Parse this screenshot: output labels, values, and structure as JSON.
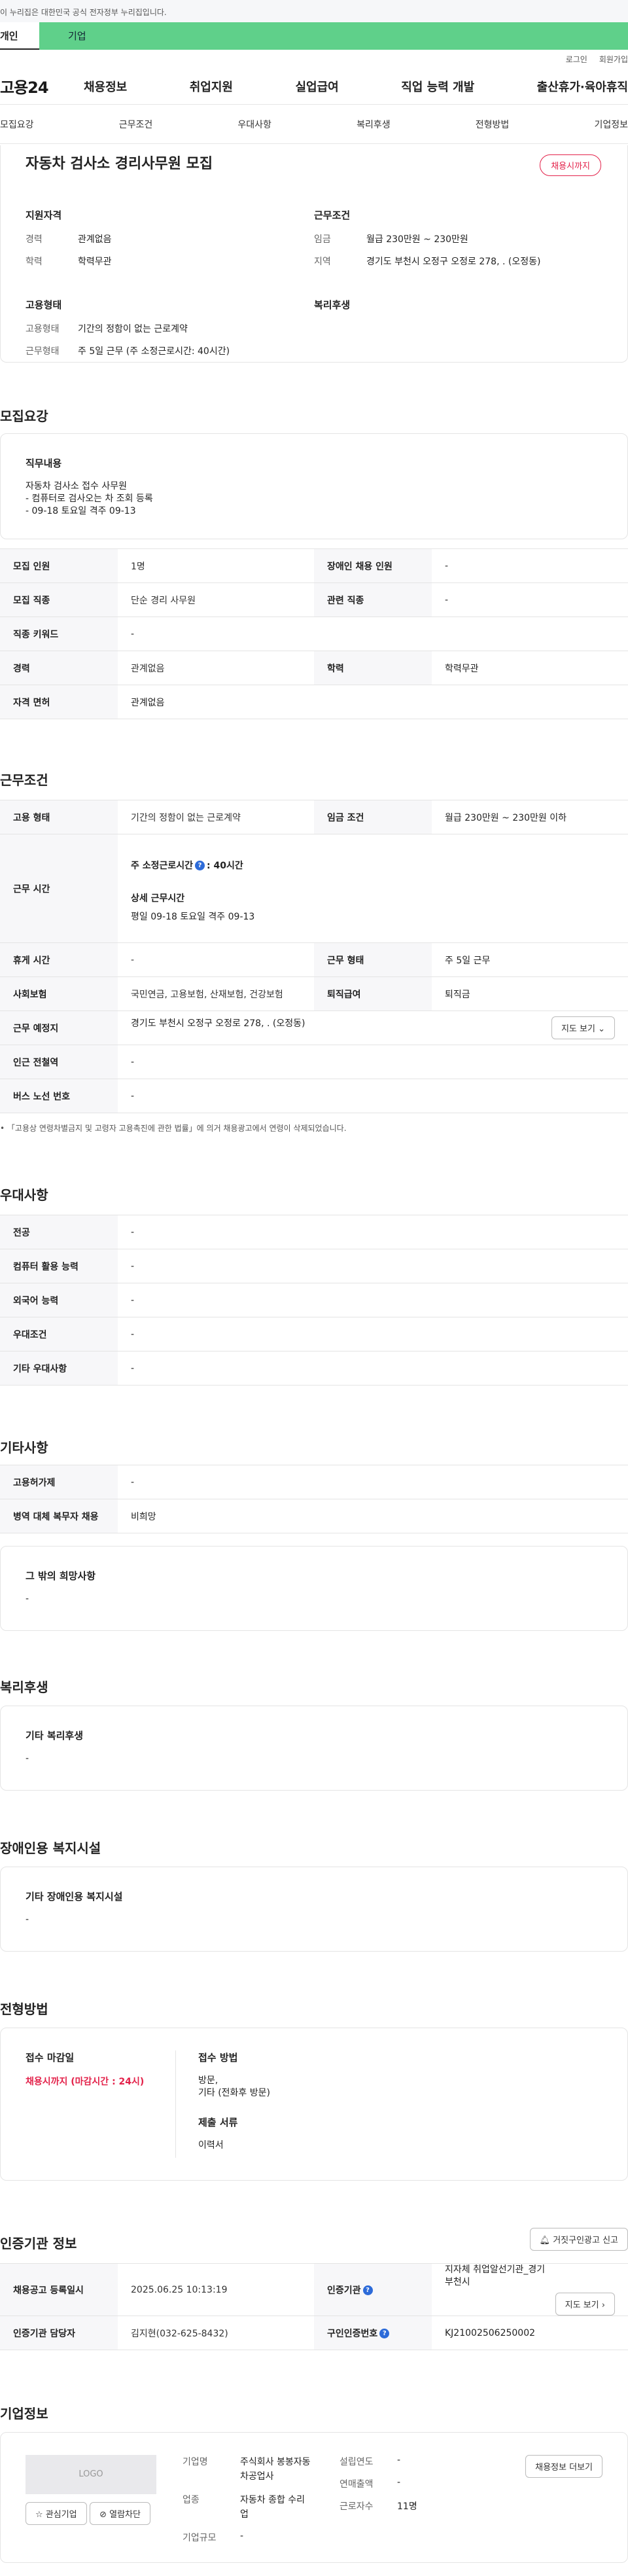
{
  "gov_banner": "이 누리집은 대한민국 공식 전자정부 누리집입니다.",
  "top_tabs": {
    "person": "개인",
    "company": "기업"
  },
  "util": {
    "login": "로그인",
    "join": "회원가입"
  },
  "gnb": {
    "logo": "고용24",
    "menu": [
      "채용정보",
      "취업지원",
      "실업급여",
      "직업 능력 개발",
      "출산휴가·육아휴직"
    ]
  },
  "anchor_tabs": [
    "모집요강",
    "근무조건",
    "우대사항",
    "복리후생",
    "전형방법",
    "기업정보"
  ],
  "summary": {
    "title": "자동차 검사소 경리사무원 모집",
    "badge": "채용시까지",
    "qual_title": "지원자격",
    "career_k": "경력",
    "career_v": "관계없음",
    "edu_k": "학력",
    "edu_v": "학력무관",
    "emp_title": "고용형태",
    "emp_k": "고용형태",
    "emp_v": "기간의 정함이 없는 근로계약",
    "work_k": "근무형태",
    "work_v": "주 5일 근무 (주 소정근로시간: 40시간)",
    "cond_title": "근무조건",
    "wage_k": "임금",
    "wage_v": "월급 230만원 ~ 230만원",
    "region_k": "지역",
    "region_v": "경기도 부천시 오정구 오정로 278, . (오정동)",
    "welfare_title": "복리후생"
  },
  "recruit": {
    "title": "모집요강",
    "duty_title": "직무내용",
    "duty_body": "자동차 검사소  접수 사무원\n- 컴퓨터로 검사오는 차 조회 등록\n- 09-18 토요일 격주 09-13",
    "rows": [
      [
        "모집 인원",
        "1명",
        "장애인 채용 인원",
        "-"
      ],
      [
        "모집 직종",
        "단순 경리 사무원",
        "관련 직종",
        "-"
      ],
      [
        "직종 키워드",
        "-"
      ],
      [
        "경력",
        "관계없음",
        "학력",
        "학력무관"
      ],
      [
        "자격 면허",
        "관계없음"
      ]
    ]
  },
  "work": {
    "title": "근무조건",
    "emp_k": "고용 형태",
    "emp_v": "기간의 정함이 없는 근로계약",
    "wage_k": "임금 조건",
    "wage_v": "월급 230만원 ~ 230만원 이하",
    "hours_k": "근무 시간",
    "hours_week": "주 소정근로시간",
    "hours_week_v": ": 40시간",
    "hours_detail_t": "상세 근무시간",
    "hours_detail_v": "평일 09-18 토요일 격주 09-13",
    "rest_k": "휴게 시간",
    "rest_v": "-",
    "type_k": "근무 형태",
    "type_v": "주 5일 근무",
    "ins_k": "사회보험",
    "ins_v": "국민연금, 고용보험, 산재보험, 건강보험",
    "sev_k": "퇴직급여",
    "sev_v": "퇴직금",
    "place_k": "근무 예정지",
    "place_v": "경기도 부천시 오정구 오정로 278, . (오정동)",
    "map_btn": "지도 보기",
    "station_k": "인근 전철역",
    "station_v": "-",
    "bus_k": "버스 노선 번호",
    "bus_v": "-",
    "note": "「고용상 연령차별금지 및 고령자 고용촉진에 관한 법률」에 의거 채용광고에서 연령이 삭제되었습니다."
  },
  "pref": {
    "title": "우대사항",
    "rows": [
      [
        "전공",
        "-"
      ],
      [
        "컴퓨터 활용 능력",
        "-"
      ],
      [
        "외국어 능력",
        "-"
      ],
      [
        "우대조건",
        "-"
      ],
      [
        "기타 우대사항",
        "-"
      ]
    ]
  },
  "etc": {
    "title": "기타사항",
    "rows": [
      [
        "고용허가제",
        "-"
      ],
      [
        "병역 대체 복무자 채용",
        "비희망"
      ]
    ],
    "box_title": "그 밖의 희망사항",
    "box_body": "-"
  },
  "welfare": {
    "title": "복리후생",
    "box_title": "기타 복리후생",
    "box_body": "-"
  },
  "disabled": {
    "title": "장애인용 복지시설",
    "box_title": "기타 장애인용 복지시설",
    "box_body": "-"
  },
  "selection": {
    "title": "전형방법",
    "deadline_t": "접수 마감일",
    "deadline_v": "채용시까지 (마감시간 : 24시)",
    "method_t": "접수 방법",
    "method_v": "방문,\n기타 (전화후 방문)",
    "docs_t": "제출 서류",
    "docs_v": "이력서"
  },
  "agency": {
    "title": "인증기관 정보",
    "report_btn": "거짓구인광고 신고",
    "date_k": "채용공고 등록일시",
    "date_v": "2025.06.25 10:13:19",
    "org_k": "인증기관",
    "org_v": "지자체 취업알선기관_경기 부천시",
    "map_btn": "지도 보기",
    "mgr_k": "인증기관 담당자",
    "mgr_v": "김지현(032-625-8432)",
    "no_k": "구인인증번호",
    "no_v": "KJ21002506250002"
  },
  "company": {
    "title": "기업정보",
    "logo": "LOGO",
    "fav_btn": "관심기업",
    "block_btn": "열람차단",
    "name_k": "기업명",
    "name_v": "주식회사 봉봉자동차공업사",
    "ind_k": "업종",
    "ind_v": "자동차 종합 수리업",
    "size_k": "기업규모",
    "size_v": "-",
    "est_k": "설립연도",
    "est_v": "-",
    "sales_k": "연매출액",
    "sales_v": "-",
    "emp_k": "근로자수",
    "emp_v": "11명",
    "more_btn": "채용정보 더보기"
  }
}
